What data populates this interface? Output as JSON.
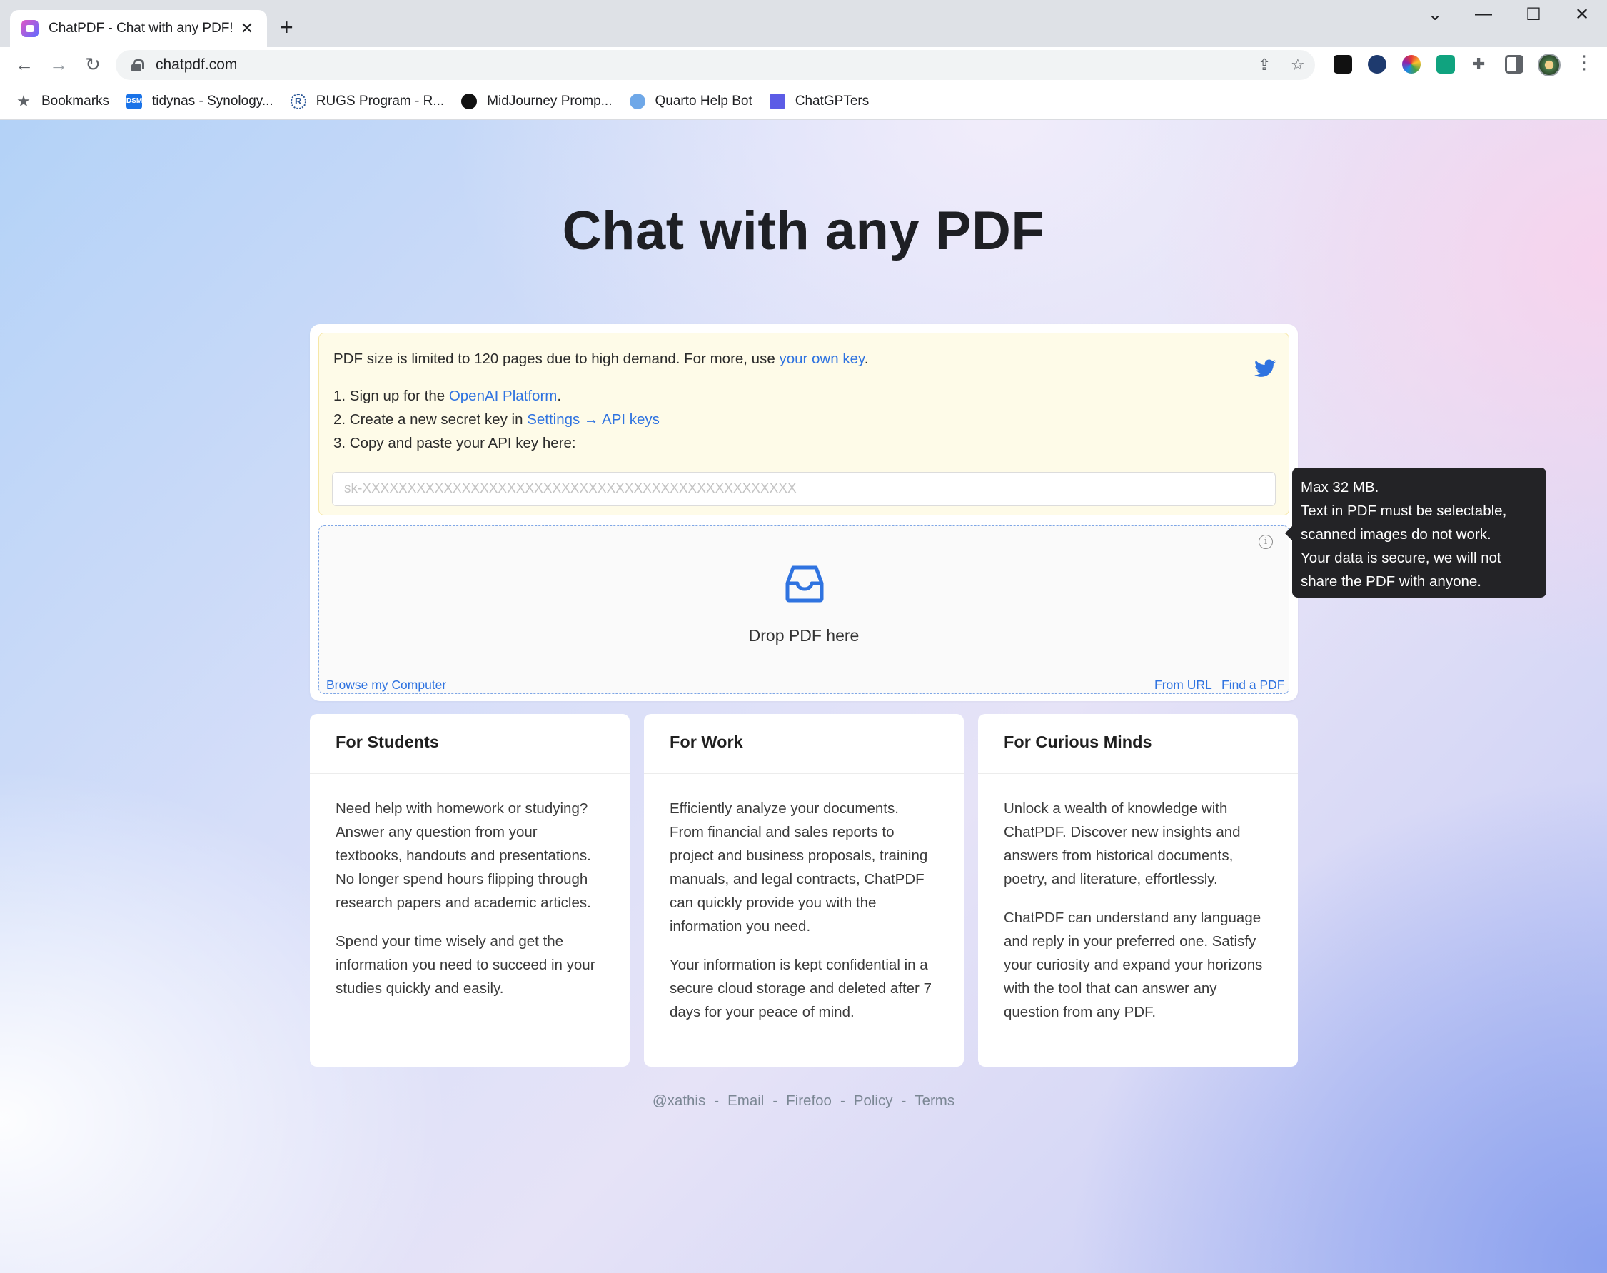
{
  "browser": {
    "tab_title": "ChatPDF - Chat with any PDF!",
    "url": "chatpdf.com",
    "bookmarks": [
      {
        "label": "Bookmarks",
        "icon": "star-icon"
      },
      {
        "label": "tidynas - Synology...",
        "icon": "dsm-icon",
        "badge": "DSM"
      },
      {
        "label": "RUGS Program - R...",
        "icon": "r-logo-icon",
        "badge": "R"
      },
      {
        "label": "MidJourney Promp...",
        "icon": "midjourney-icon"
      },
      {
        "label": "Quarto Help Bot",
        "icon": "globe-icon"
      },
      {
        "label": "ChatGPTers",
        "icon": "chatgpters-icon"
      }
    ]
  },
  "hero": {
    "title": "Chat with any PDF"
  },
  "notice": {
    "intro_prefix": "PDF size is limited to 120 pages due to high demand. For more, use ",
    "intro_link": "your own key",
    "intro_suffix": ".",
    "step1_prefix": "1. Sign up for the ",
    "step1_link": "OpenAI Platform",
    "step1_suffix": ".",
    "step2_prefix": "2. Create a new secret key in ",
    "step2_link": "Settings → API keys",
    "step3": "3. Copy and paste your API key here:",
    "key_placeholder": "sk-XXXXXXXXXXXXXXXXXXXXXXXXXXXXXXXXXXXXXXXXXXXXXXXX"
  },
  "dropzone": {
    "drop_text": "Drop PDF here",
    "browse": "Browse my Computer",
    "from_url": "From URL",
    "find_pdf": "Find a PDF",
    "info_glyph": "i"
  },
  "tooltip": {
    "lines": [
      "Max 32 MB.",
      "Text in PDF must be selectable,",
      "scanned images do not work.",
      "Your data is secure, we will not",
      "share the PDF with anyone."
    ]
  },
  "features": [
    {
      "title": "For Students",
      "paragraphs": [
        [
          "Need help with homework or studying?",
          "Answer any question from your",
          "textbooks, handouts and presentations.",
          "No longer spend hours flipping through",
          "research papers and academic articles."
        ],
        [
          "Spend your time wisely and get the",
          "information you need to succeed in your",
          "studies quickly and easily."
        ]
      ]
    },
    {
      "title": "For Work",
      "paragraphs": [
        [
          "Efficiently analyze your documents.",
          "From financial and sales reports to",
          "project and business proposals, training",
          "manuals, and legal contracts, ChatPDF",
          "can quickly provide you with the",
          "information you need."
        ],
        [
          "Your information is kept confidential in a",
          "secure cloud storage and deleted after 7",
          "days for your peace of mind."
        ]
      ]
    },
    {
      "title": "For Curious Minds",
      "paragraphs": [
        [
          "Unlock a wealth of knowledge with",
          "ChatPDF. Discover new insights and",
          "answers from historical documents,",
          "poetry, and literature, effortlessly."
        ],
        [
          "ChatPDF can understand any language",
          "and reply in your preferred one. Satisfy",
          "your curiosity and expand your horizons",
          "with the tool that can answer any",
          "question from any PDF."
        ]
      ]
    }
  ],
  "footer": {
    "links": [
      "@xathis",
      "Email",
      "Firefoo",
      "Policy",
      "Terms"
    ],
    "separator": "-"
  },
  "colors": {
    "link": "#2f73e0",
    "notice_bg": "#fefbe8",
    "tooltip_bg": "#232326",
    "twitter": "#2f73e0"
  }
}
